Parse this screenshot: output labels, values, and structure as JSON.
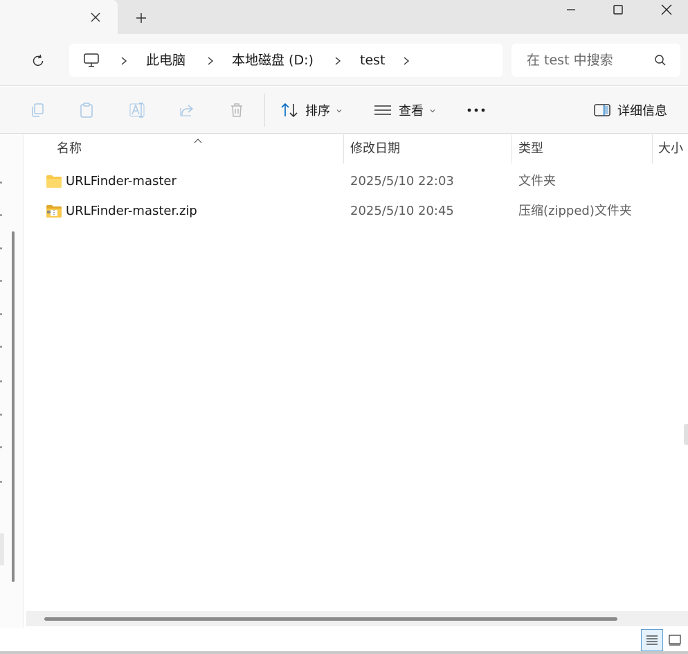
{
  "tabs": {
    "new_tab_label": "+"
  },
  "window": {
    "minimize": "minimize",
    "maximize": "maximize",
    "close": "close"
  },
  "address": {
    "crumbs": [
      "此电脑",
      "本地磁盘 (D:)",
      "test"
    ]
  },
  "search": {
    "placeholder": "在 test 中搜索"
  },
  "toolbar": {
    "sort_label": "排序",
    "view_label": "查看",
    "more_label": "•••",
    "details_label": "详细信息"
  },
  "columns": {
    "name": "名称",
    "date": "修改日期",
    "type": "类型",
    "size": "大小"
  },
  "files": [
    {
      "name": "URLFinder-master",
      "date": "2025/5/10 22:03",
      "type": "文件夹",
      "icon": "folder-icon"
    },
    {
      "name": "URLFinder-master.zip",
      "date": "2025/5/10 20:45",
      "type": "压缩(zipped)文件夹",
      "icon": "zip-folder-icon"
    }
  ],
  "colors": {
    "accent": "#0067c0",
    "folder": "#f8c94a",
    "chrome_bg": "#f7f7f7"
  }
}
